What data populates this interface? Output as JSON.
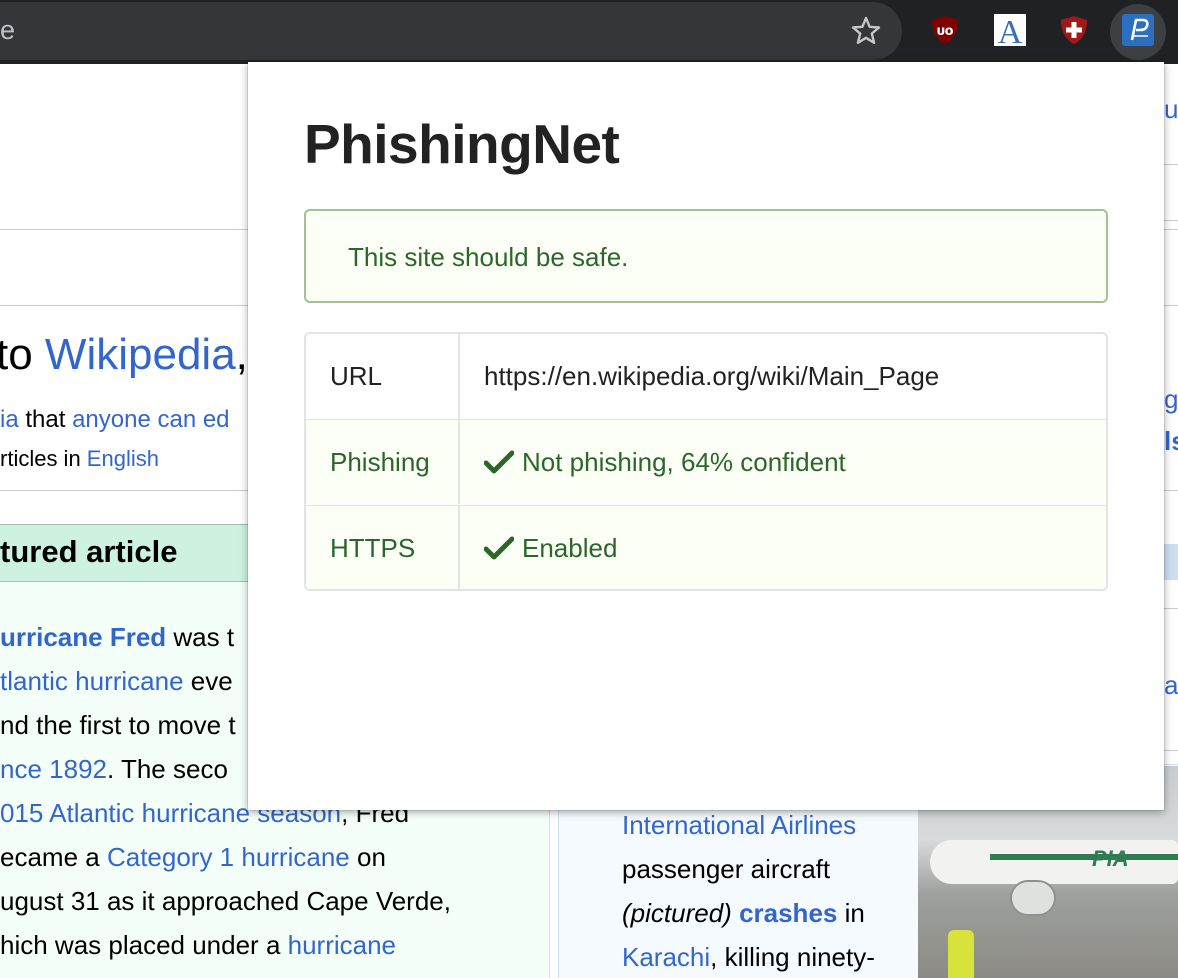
{
  "browser": {
    "omnibox_text": "e",
    "extensions": [
      "ublock-origin",
      "font-a",
      "shield-plus",
      "phishingnet"
    ]
  },
  "background_page": {
    "welcome_prefix": "to ",
    "welcome_link": "Wikipedia",
    "welcome_suffix": ",",
    "tagline_link1": "ia",
    "tagline_mid": " that ",
    "tagline_link2": "anyone can ed",
    "tagline2_prefix": "rticles in ",
    "tagline2_link": "English",
    "featured_title": "tured article",
    "featured_lines": [
      {
        "link": "urricane Fred",
        "text": " was t",
        "bold": true
      },
      {
        "link": "tlantic hurricane",
        "text": " eve"
      },
      {
        "link": "",
        "text": "nd the first to move t"
      },
      {
        "link": "nce 1892",
        "text": ". The seco"
      },
      {
        "link": "015 Atlantic hurricane season",
        "text": ", Fred"
      },
      {
        "prefix": "ecame a ",
        "link": "Category 1 hurricane",
        "text": " on"
      },
      {
        "link": "",
        "text": "ugust 31 as it approached Cape Verde,"
      },
      {
        "prefix": "hich was placed under a ",
        "link": "hurricane",
        "text": ""
      }
    ],
    "news_lines": [
      {
        "link": "International Airlines",
        "text": ""
      },
      {
        "link": "",
        "text": "passenger aircraft"
      },
      {
        "italic": "(pictured)",
        "link": "crashes",
        "text": " in"
      },
      {
        "link": "Karachi",
        "text": ", killing ninety-"
      }
    ],
    "photo_tail_text": "PIA",
    "right_fragments": [
      "ur",
      "g",
      "ls",
      "a"
    ]
  },
  "popup": {
    "title": "PhishingNet",
    "alert_message": "This site should be safe.",
    "rows": [
      {
        "label": "URL",
        "value": "https://en.wikipedia.org/wiki/Main_Page",
        "positive": false
      },
      {
        "label": "Phishing",
        "value": "Not phishing, 64% confident",
        "positive": true,
        "icon": "checkmark-icon"
      },
      {
        "label": "HTTPS",
        "value": "Enabled",
        "positive": true,
        "icon": "checkmark-icon"
      }
    ],
    "colors": {
      "positive_text": "#2c662d",
      "positive_bg": "#fcfff5",
      "alert_border": "#a3c293"
    }
  }
}
